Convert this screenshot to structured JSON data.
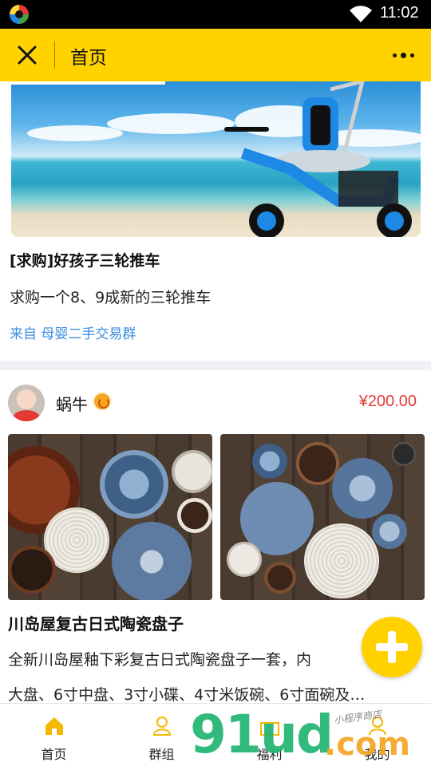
{
  "status_bar": {
    "time": "11:02"
  },
  "header": {
    "title": "首页",
    "close_icon": "close-icon",
    "more_icon": "more-icon"
  },
  "feed": [
    {
      "title": "[求购]好孩子三轮推车",
      "description": "求购一个8、9成新的三轮推车",
      "source": "来自 母婴二手交易群"
    },
    {
      "user": {
        "name": "蜗牛"
      },
      "price": "¥200.00",
      "title": "川岛屋复古日式陶瓷盘子",
      "description_lines": [
        "全新川岛屋釉下彩复古日式陶瓷盘子一套，内",
        "大盘、6寸中盘、3寸小碟、4寸米饭碗、6寸面碗及…"
      ]
    }
  ],
  "tabbar": [
    {
      "label": "首页",
      "icon": "home-icon",
      "active": true
    },
    {
      "label": "群组",
      "icon": "group-icon",
      "active": false
    },
    {
      "label": "福利",
      "icon": "gift-icon",
      "active": false
    },
    {
      "label": "我的",
      "icon": "user-icon",
      "active": false
    }
  ],
  "watermark": {
    "brand": "91ud",
    "suffix": ".com",
    "slogan": "小程序商店"
  },
  "colors": {
    "accent": "#ffd200",
    "price": "#e53935",
    "link": "#3b8de0",
    "icon": "#f5b800"
  }
}
